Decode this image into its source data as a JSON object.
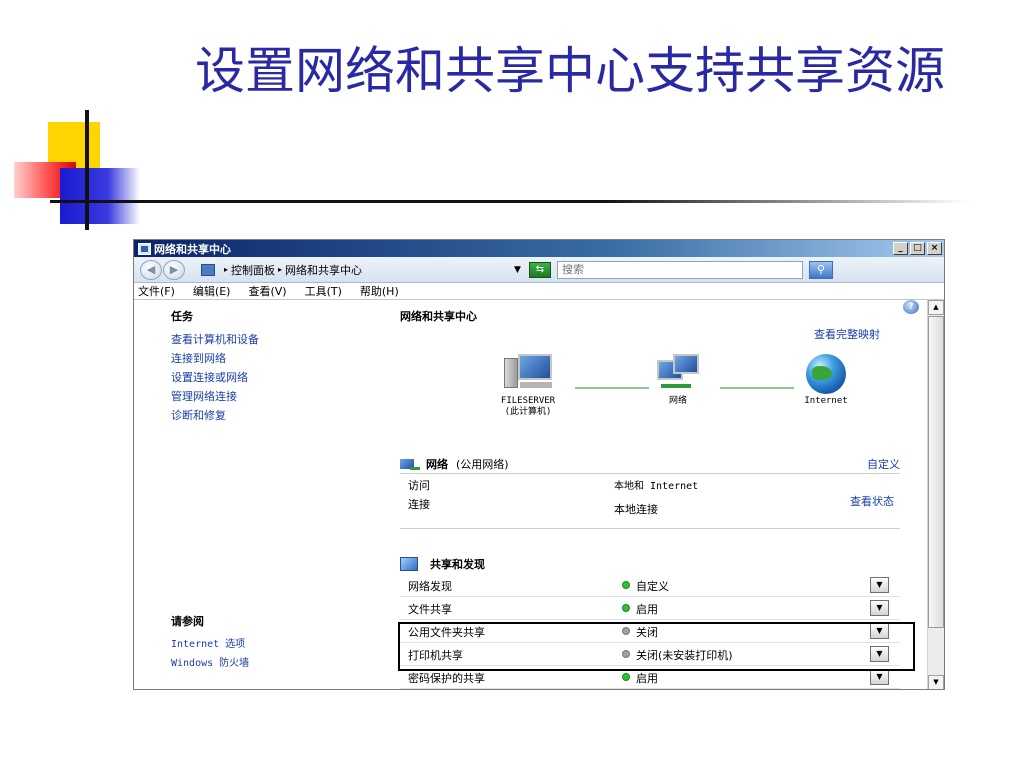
{
  "slide": {
    "title": "设置网络和共享中心支持共享资源"
  },
  "window": {
    "title": "网络和共享中心",
    "minimize": "_",
    "maximize": "□",
    "close": "×"
  },
  "address": {
    "back": "◀",
    "forward": "▶",
    "crumbs": [
      "控制面板",
      "网络和共享中心"
    ],
    "separator": "▸",
    "dropdown": "▼",
    "refresh": "⇆",
    "search_placeholder": "搜索",
    "search_button": "⚲"
  },
  "menu": {
    "items": [
      "文件(F)",
      "编辑(E)",
      "查看(V)",
      "工具(T)",
      "帮助(H)"
    ]
  },
  "sidebar": {
    "tasks_heading": "任务",
    "tasks": [
      "查看计算机和设备",
      "连接到网络",
      "设置连接或网络",
      "管理网络连接",
      "诊断和修复"
    ],
    "see_also_heading": "请参阅",
    "see_also": [
      "Internet 选项",
      "Windows 防火墙"
    ]
  },
  "main": {
    "title": "网络和共享中心",
    "view_full_map": "查看完整映射",
    "nodes": {
      "computer_name": "FILESERVER",
      "computer_sub": "(此计算机)",
      "network": "网络",
      "internet": "Internet"
    },
    "network_section": {
      "name": "网络",
      "type": "(公用网络)",
      "customize": "自定义",
      "access_label": "访问",
      "access_value": "本地和 Internet",
      "connection_label": "连接",
      "connection_value": "本地连接",
      "view_status": "查看状态"
    },
    "sharing_section": {
      "title": "共享和发现",
      "rows": [
        {
          "label": "网络发现",
          "value": "自定义",
          "state": "on"
        },
        {
          "label": "文件共享",
          "value": "启用",
          "state": "on"
        },
        {
          "label": "公用文件夹共享",
          "value": "关闭",
          "state": "off"
        },
        {
          "label": "打印机共享",
          "value": "关闭(未安装打印机)",
          "state": "off"
        },
        {
          "label": "密码保护的共享",
          "value": "启用",
          "state": "on"
        }
      ],
      "dropdown_glyph": "▼"
    }
  },
  "help": "?",
  "scroll": {
    "up": "▲",
    "down": "▼"
  },
  "colors": {
    "title": "#2929a3",
    "link": "#1a3ea8",
    "status_on": "#2fbf3a",
    "status_off": "#a0a0a0"
  }
}
